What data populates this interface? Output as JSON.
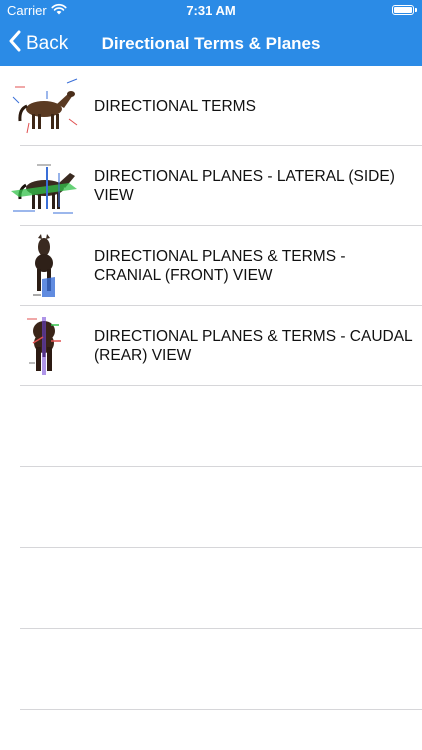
{
  "status_bar": {
    "carrier": "Carrier",
    "time": "7:31 AM"
  },
  "nav": {
    "back_label": "Back",
    "title": "Directional Terms & Planes",
    "bar_color": "#2b8be6"
  },
  "list": {
    "items": [
      {
        "label": "DIRECTIONAL TERMS",
        "thumbnail": "horse-side-terms-image"
      },
      {
        "label": "DIRECTIONAL PLANES - LATERAL (SIDE) VIEW",
        "thumbnail": "horse-side-planes-image"
      },
      {
        "label": "DIRECTIONAL PLANES & TERMS - CRANIAL (FRONT) VIEW",
        "thumbnail": "horse-front-view-image"
      },
      {
        "label": "DIRECTIONAL PLANES & TERMS - CAUDAL (REAR) VIEW",
        "thumbnail": "horse-rear-view-image"
      }
    ]
  }
}
